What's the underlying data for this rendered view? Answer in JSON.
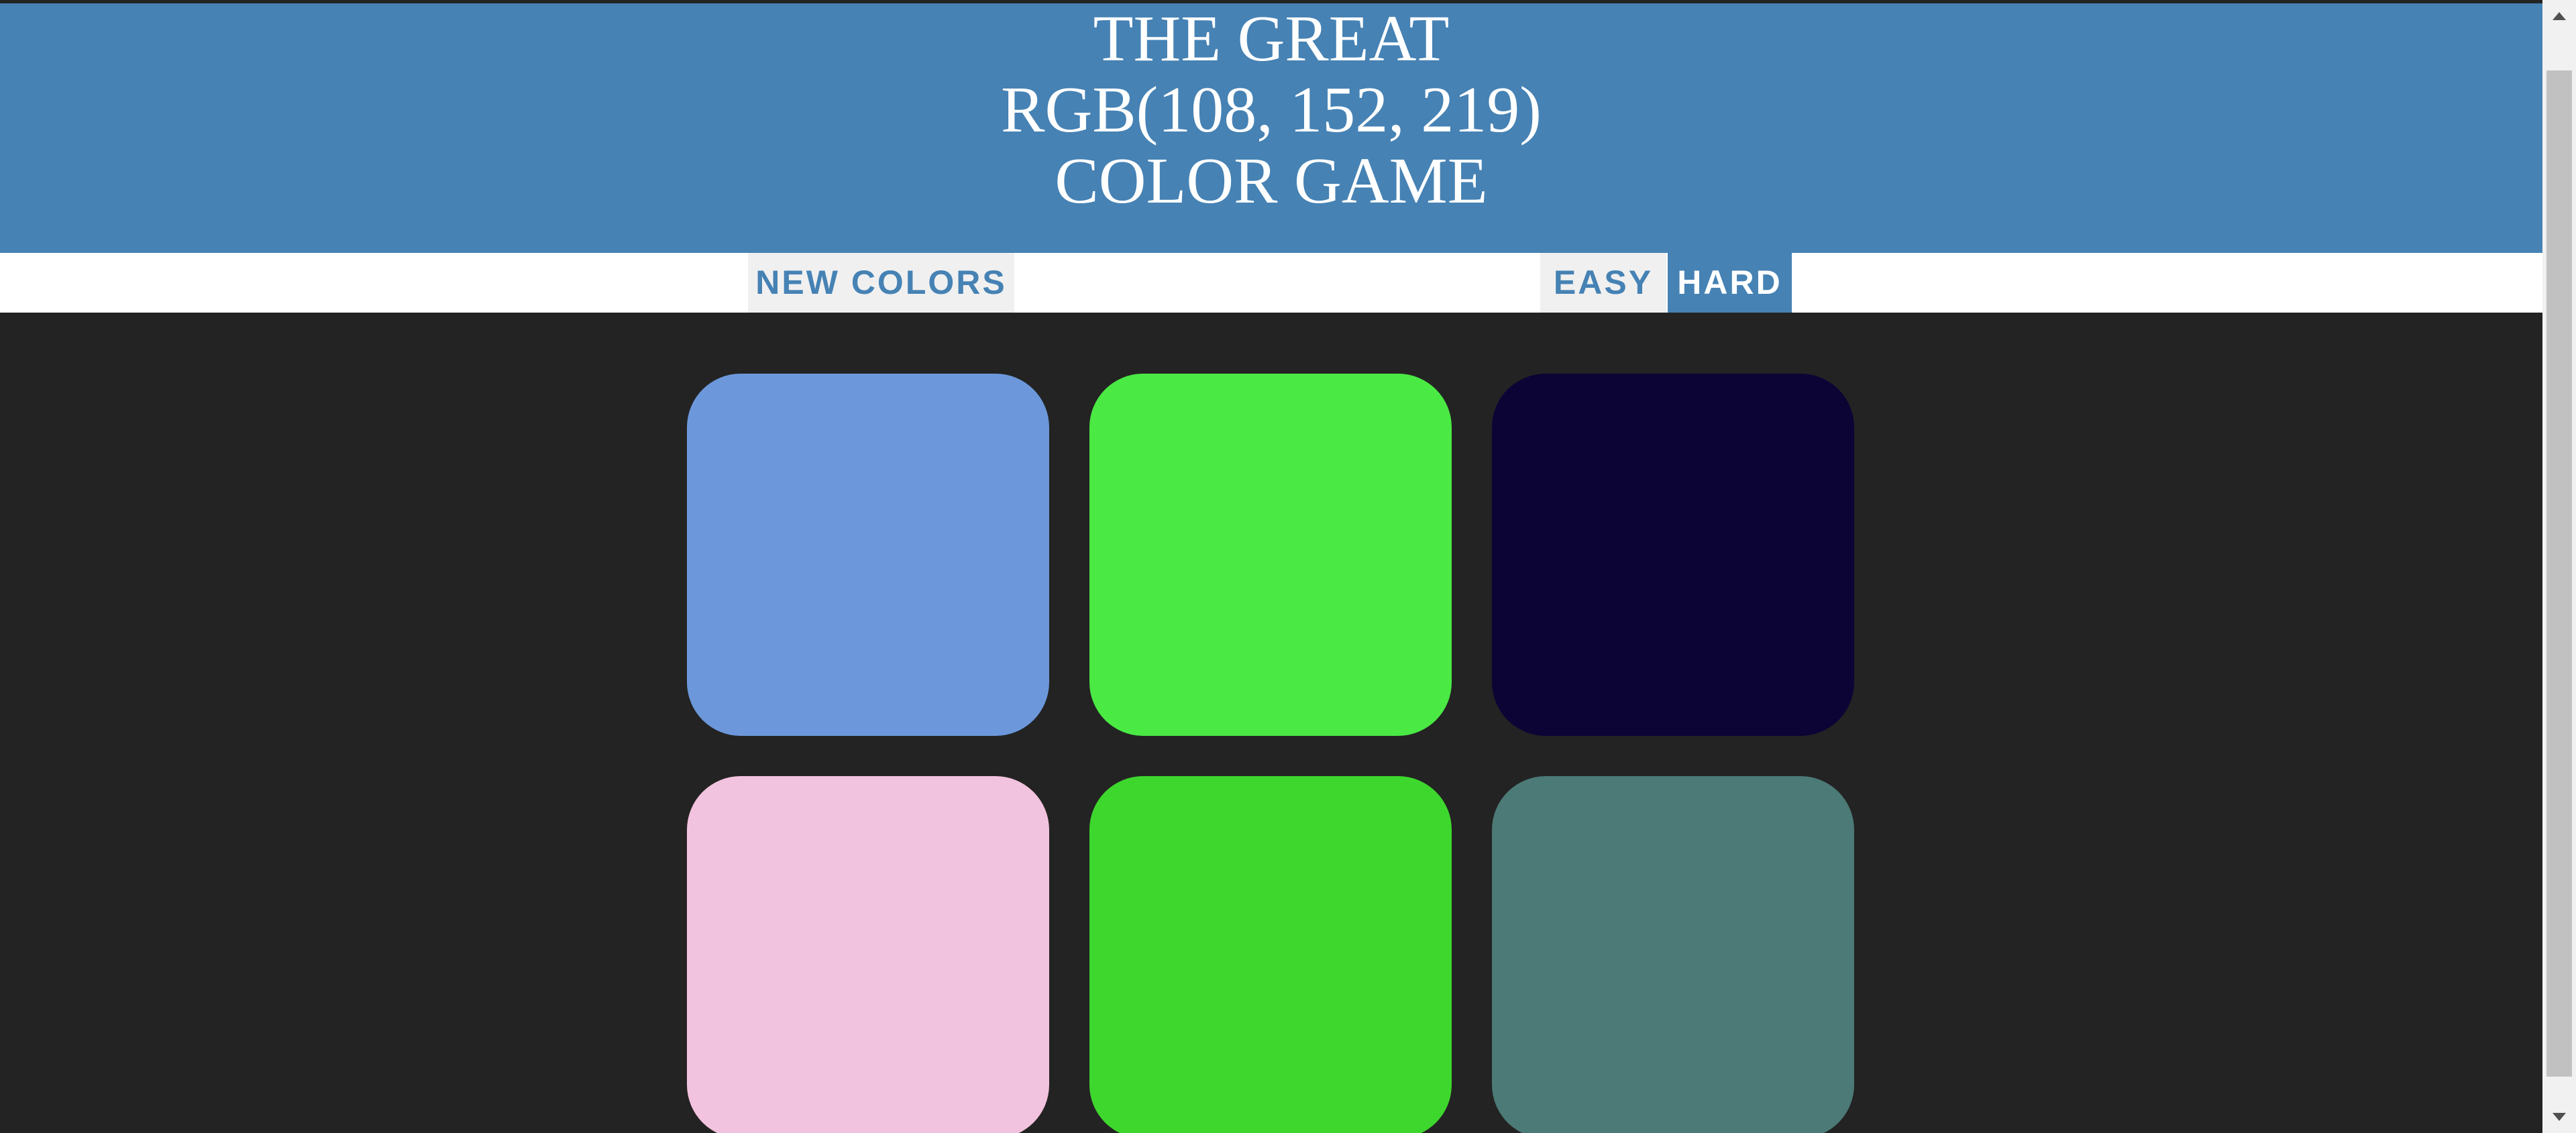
{
  "header": {
    "title_line1": "THE GREAT",
    "title_line2": "RGB(108, 152, 219)",
    "title_line3": "COLOR GAME",
    "background_color": "#4682b4"
  },
  "controls": {
    "new_colors_label": "NEW COLORS",
    "easy_label": "EASY",
    "hard_label": "HARD",
    "selected_mode": "HARD"
  },
  "squares": [
    {
      "color": "#6c98db"
    },
    {
      "color": "#4ae944"
    },
    {
      "color": "#0b0435"
    },
    {
      "color": "#f2c3de"
    },
    {
      "color": "#3ed72d"
    },
    {
      "color": "#4c7a76"
    }
  ],
  "board_background": "#232323"
}
